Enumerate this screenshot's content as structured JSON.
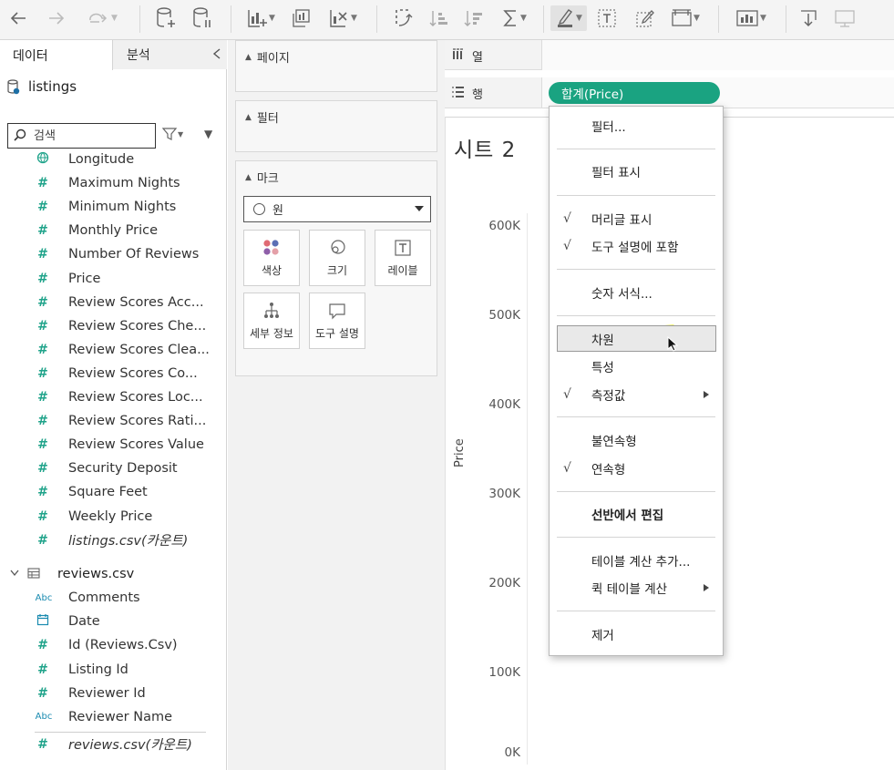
{
  "colors": {
    "accent": "#1aa381",
    "number_icon": "#1fa38a",
    "string_icon": "#1a8bb0",
    "highlight": "#e8f000"
  },
  "tabs": {
    "data": "데이터",
    "analysis": "분석"
  },
  "datasource": {
    "name": "listings"
  },
  "search": {
    "placeholder": "검색"
  },
  "fields": [
    {
      "label": "Longitude",
      "type": "geo",
      "italic": false
    },
    {
      "label": "Maximum Nights",
      "type": "number",
      "italic": false
    },
    {
      "label": "Minimum Nights",
      "type": "number",
      "italic": false
    },
    {
      "label": "Monthly Price",
      "type": "number",
      "italic": false
    },
    {
      "label": "Number Of Reviews",
      "type": "number",
      "italic": false
    },
    {
      "label": "Price",
      "type": "number",
      "italic": false
    },
    {
      "label": "Review Scores Acc...",
      "type": "number",
      "italic": false
    },
    {
      "label": "Review Scores Che...",
      "type": "number",
      "italic": false
    },
    {
      "label": "Review Scores Clea...",
      "type": "number",
      "italic": false
    },
    {
      "label": "Review Scores Co...",
      "type": "number",
      "italic": false
    },
    {
      "label": "Review Scores Loc...",
      "type": "number",
      "italic": false
    },
    {
      "label": "Review Scores Rati...",
      "type": "number",
      "italic": false
    },
    {
      "label": "Review Scores Value",
      "type": "number",
      "italic": false
    },
    {
      "label": "Security Deposit",
      "type": "number",
      "italic": false
    },
    {
      "label": "Square Feet",
      "type": "number",
      "italic": false
    },
    {
      "label": "Weekly Price",
      "type": "number",
      "italic": false
    },
    {
      "label": "listings.csv(카운트)",
      "type": "number",
      "italic": true
    }
  ],
  "reviews_group": {
    "name": "reviews.csv"
  },
  "review_fields": [
    {
      "label": "Comments",
      "type": "string",
      "italic": false
    },
    {
      "label": "Date",
      "type": "date",
      "italic": false
    },
    {
      "label": "Id (Reviews.Csv)",
      "type": "number",
      "italic": false
    },
    {
      "label": "Listing Id",
      "type": "number",
      "italic": false
    },
    {
      "label": "Reviewer Id",
      "type": "number",
      "italic": false
    },
    {
      "label": "Reviewer Name",
      "type": "string",
      "italic": false
    },
    {
      "label": "reviews.csv(카운트)",
      "type": "number",
      "italic": true
    }
  ],
  "cards": {
    "pages": "페이지",
    "filters": "필터",
    "marks": "마크"
  },
  "marks": {
    "type": "원",
    "buttons": [
      {
        "label": "색상",
        "icon": "color-icon"
      },
      {
        "label": "크기",
        "icon": "size-icon"
      },
      {
        "label": "레이블",
        "icon": "label-icon"
      },
      {
        "label": "세부 정보",
        "icon": "detail-icon"
      },
      {
        "label": "도구 설명",
        "icon": "tooltip-icon"
      }
    ]
  },
  "shelves": {
    "columns": "열",
    "rows": "행",
    "row_pill": "합계(Price)"
  },
  "sheet": {
    "title": "시트 2"
  },
  "axis": {
    "label": "Price",
    "ticks": [
      "600K",
      "500K",
      "400K",
      "300K",
      "200K",
      "100K",
      "0K"
    ]
  },
  "context_menu": {
    "items": [
      {
        "label": "필터...",
        "checked": false,
        "submenu": false,
        "bold": false
      },
      {
        "label": "필터 표시",
        "checked": false,
        "submenu": false,
        "bold": false
      },
      {
        "label": "머리글 표시",
        "checked": true,
        "submenu": false,
        "bold": false
      },
      {
        "label": "도구 설명에 포함",
        "checked": true,
        "submenu": false,
        "bold": false
      },
      {
        "label": "숫자 서식...",
        "checked": false,
        "submenu": false,
        "bold": false
      },
      {
        "label": "차원",
        "checked": false,
        "submenu": false,
        "bold": false,
        "hover": true
      },
      {
        "label": "특성",
        "checked": false,
        "submenu": false,
        "bold": false
      },
      {
        "label": "측정값",
        "checked": true,
        "submenu": true,
        "bold": false
      },
      {
        "label": "불연속형",
        "checked": false,
        "submenu": false,
        "bold": false
      },
      {
        "label": "연속형",
        "checked": true,
        "submenu": false,
        "bold": false
      },
      {
        "label": "선반에서 편집",
        "checked": false,
        "submenu": false,
        "bold": true
      },
      {
        "label": "테이블 계산 추가...",
        "checked": false,
        "submenu": false,
        "bold": false
      },
      {
        "label": "퀵 테이블 계산",
        "checked": false,
        "submenu": true,
        "bold": false
      },
      {
        "label": "제거",
        "checked": false,
        "submenu": false,
        "bold": false
      }
    ],
    "check_glyph": "√"
  }
}
